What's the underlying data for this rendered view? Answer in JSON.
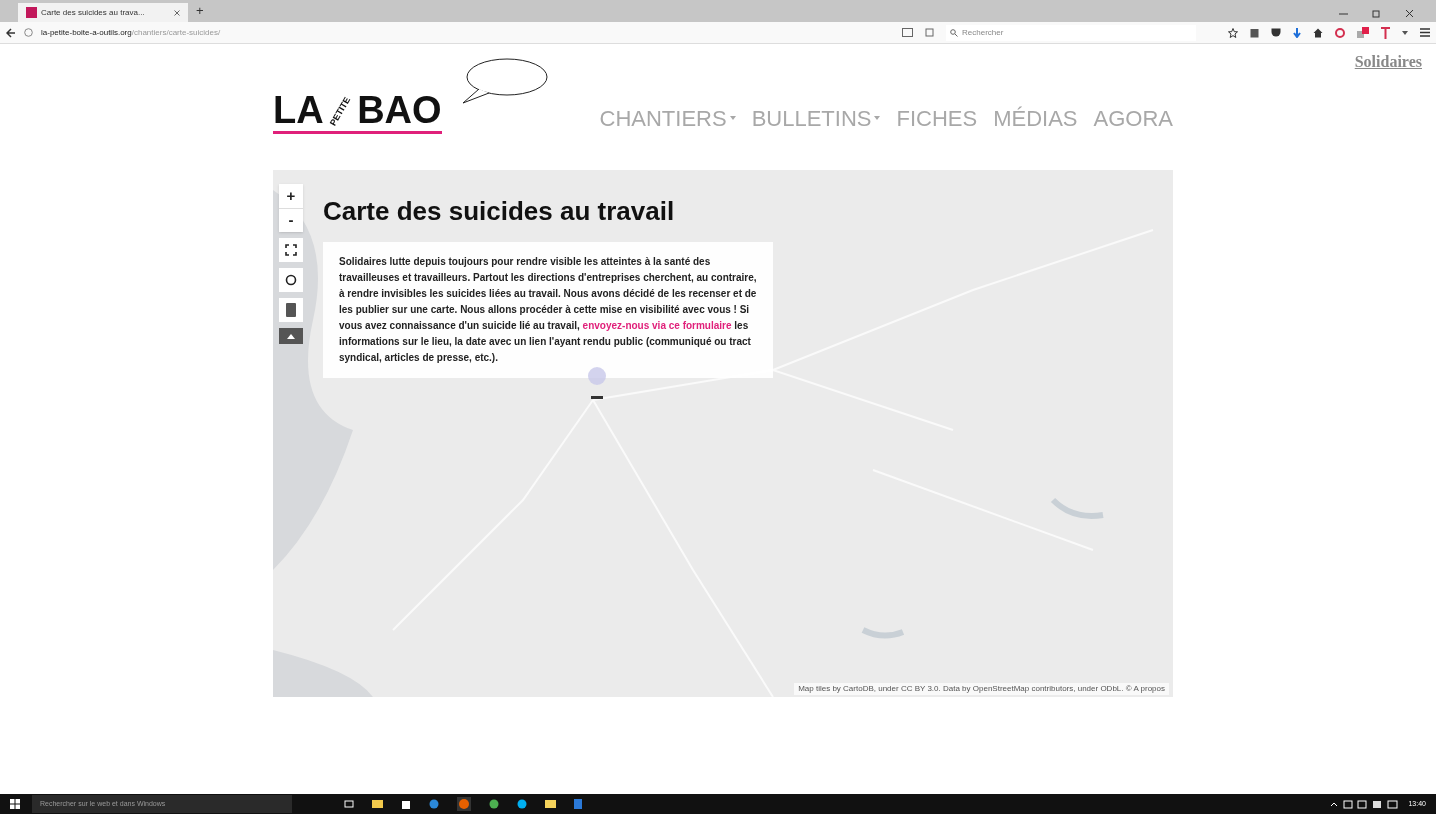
{
  "browser": {
    "tab_title": "Carte des suicides au trava...",
    "new_tab": "+",
    "url_host": "la-petite-boite-a-outils.org",
    "url_path": "/chantiers/carte-suicides/",
    "search": {
      "placeholder": "Rechercher"
    }
  },
  "site": {
    "logo": {
      "left": "LA",
      "small": "PETITE",
      "right": "BAO"
    },
    "partner": "Solidaires",
    "nav": [
      {
        "label": "CHANTIERS",
        "has_dropdown": true
      },
      {
        "label": "BULLETINS",
        "has_dropdown": true
      },
      {
        "label": "FICHES",
        "has_dropdown": false
      },
      {
        "label": "MÉDIAS",
        "has_dropdown": false
      },
      {
        "label": "AGORA",
        "has_dropdown": false
      }
    ]
  },
  "map": {
    "zoom_in": "+",
    "zoom_out": "-",
    "title": "Carte des suicides au travail",
    "intro_before": "Solidaires lutte depuis toujours pour rendre visible les atteintes à la santé des travailleuses et travailleurs. Partout les directions d'entreprises cherchent, au contraire, à rendre invisibles les suicides liées au travail. Nous avons décidé de les recenser et de les publier sur une carte. Nous allons procéder à cette mise en visibilité avec vous ! Si vous avez connaissance d'un suicide lié au travail,",
    "intro_link": "envoyez-nous via ce formulaire",
    "intro_after": "les informations sur le lieu, la date avec un lien l'ayant rendu public (communiqué ou tract syndical, articles de presse, etc.).",
    "attribution": "Map tiles by CartoDB, under CC BY 3.0. Data by OpenStreetMap contributors, under ODbL. © A propos"
  },
  "taskbar": {
    "search": "Rechercher sur le web et dans Windows",
    "time": "13:40"
  }
}
